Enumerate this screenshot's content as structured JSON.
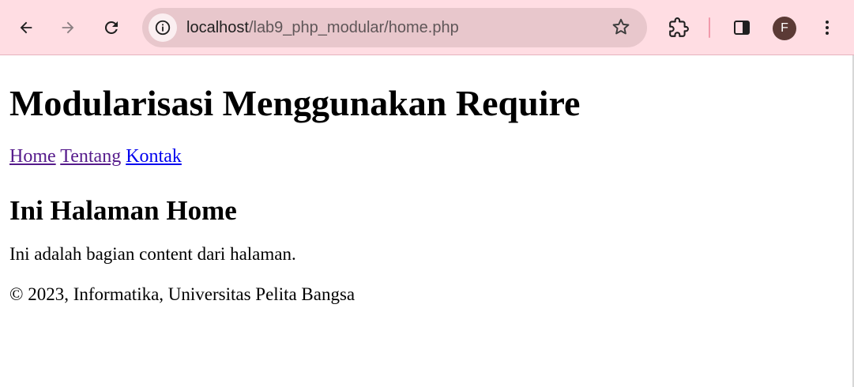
{
  "browser": {
    "url_host": "localhost",
    "url_path": "/lab9_php_modular/home.php",
    "profile_initial": "F",
    "toolbar_color": "#ffdde3",
    "omnibox_color": "#e8c7cc",
    "icons": {
      "back": "arrow-left-icon",
      "forward": "arrow-right-icon",
      "reload": "reload-icon",
      "site_info": "info-icon",
      "bookmark": "star-icon",
      "extensions": "puzzle-icon",
      "side_panel": "side-panel-icon",
      "menu": "kebab-menu-icon"
    }
  },
  "page": {
    "heading": "Modularisasi Menggunakan Require",
    "nav": [
      {
        "label": "Home",
        "visited": true
      },
      {
        "label": "Tentang",
        "visited": true
      },
      {
        "label": "Kontak",
        "visited": false
      }
    ],
    "section_title": "Ini Halaman Home",
    "body_text": "Ini adalah bagian content dari halaman.",
    "footer_text": "© 2023, Informatika, Universitas Pelita Bangsa",
    "visited_link_color": "#551a8b",
    "link_color": "#0000ee"
  }
}
